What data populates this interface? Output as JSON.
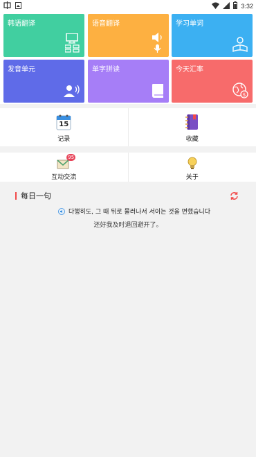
{
  "status_bar": {
    "left_icons": [
      "app-notification-icon",
      "image-notification-icon"
    ],
    "time": "3:32",
    "right_icons": [
      "wifi-icon",
      "signal-icon",
      "battery-icon"
    ]
  },
  "tiles": [
    {
      "label": "韩语翻译",
      "icon": "translate-screen-icon",
      "color": "#41cfa0"
    },
    {
      "label": "语音翻译",
      "icon": "voice-icon",
      "color": "#fdb041"
    },
    {
      "label": "学习单词",
      "icon": "study-icon",
      "color": "#3cb0f2"
    },
    {
      "label": "发音单元",
      "icon": "speaker-person-icon",
      "color": "#5f6be8"
    },
    {
      "label": "单字拼读",
      "icon": "book-icon",
      "color": "#a67ef7"
    },
    {
      "label": "今天汇率",
      "icon": "currency-globe-icon",
      "color": "#f76b6b"
    }
  ],
  "grid": {
    "record": {
      "label": "记录",
      "icon": "calendar-icon",
      "calendar_day": "15"
    },
    "favorites": {
      "label": "收藏",
      "icon": "notebook-icon"
    },
    "community": {
      "label": "互动交流",
      "icon": "mail-icon",
      "badge": "95"
    },
    "about": {
      "label": "关于",
      "icon": "lightbulb-icon"
    }
  },
  "daily_sentence": {
    "title": "每日一句",
    "korean": "다행히도, 그 때 뒤로 물러나서 서이는 것을 면했습니다",
    "chinese": "还好我及时退回避开了。"
  },
  "colors": {
    "accent_red": "#f24a4a",
    "background": "#f2f2f2"
  }
}
